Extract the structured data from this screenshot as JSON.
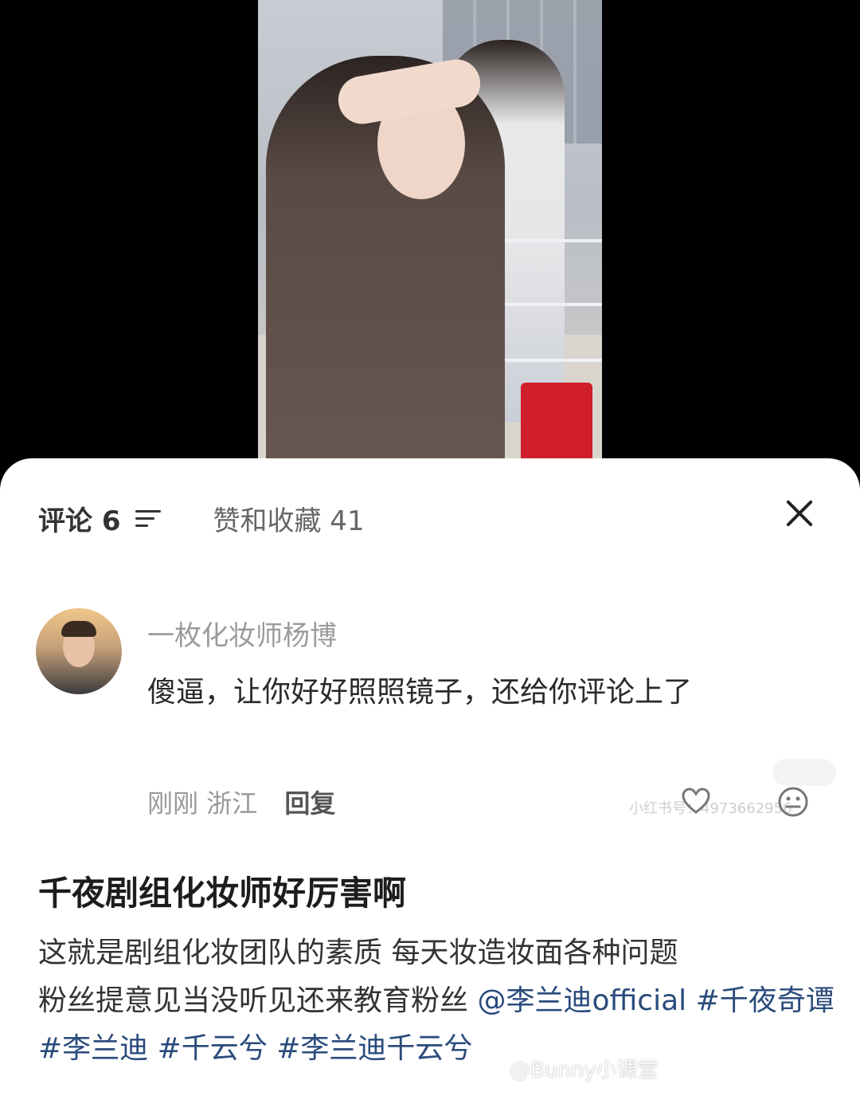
{
  "tabs": {
    "comments_label": "评论 6",
    "likes_label": "赞和收藏 41"
  },
  "comment": {
    "author": "一枚化妆师杨博",
    "text": "傻逼，让你好好照照镜子，还给你评论上了",
    "time": "刚刚",
    "location": "浙江",
    "reply_label": "回复",
    "side_watermark": "小红书号：4973662956"
  },
  "post": {
    "title": "千夜剧组化妆师好厉害啊",
    "body_line1": "这就是剧组化妆团队的素质 每天妆造妆面各种问题",
    "body_line2_text": "粉丝提意见当没听见还来教育粉丝 ",
    "mention": "@李兰迪official",
    "tags": [
      "#千夜奇谭",
      "#李兰迪",
      "#千云兮",
      "#李兰迪千云兮"
    ]
  },
  "watermark": "@Bunny小课堂",
  "icons": {
    "sort": "sort-icon",
    "close": "close-icon",
    "like": "heart-icon",
    "emoji": "emoji-icon"
  },
  "colors": {
    "link": "#2a4b7c",
    "sheet": "#ffffff",
    "backdrop": "#000000"
  }
}
